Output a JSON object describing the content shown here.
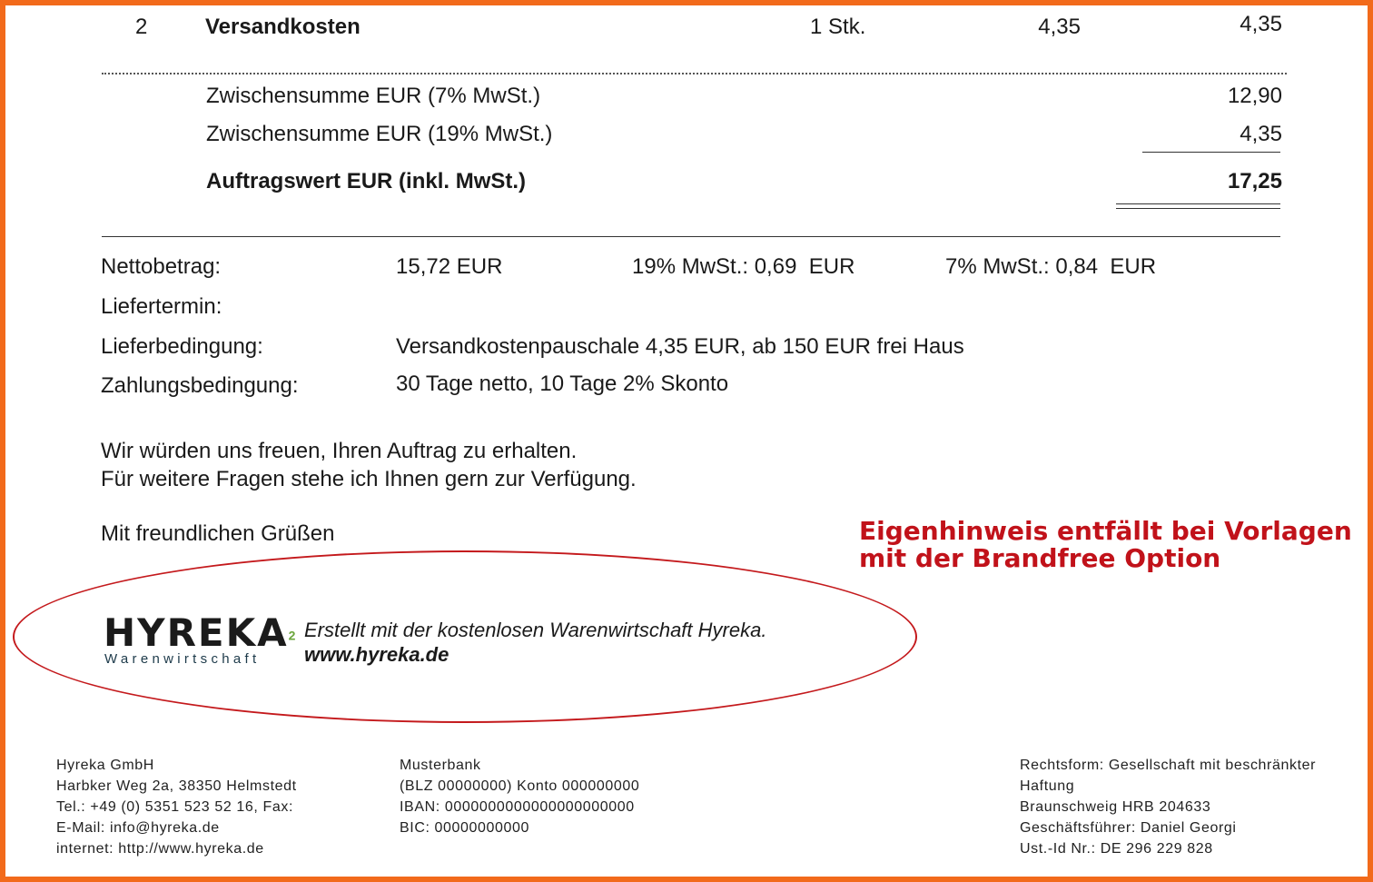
{
  "item_row": {
    "pos": "2",
    "name": "Versandkosten",
    "qty": "1 Stk.",
    "unit_price": "4,35",
    "total": "4,35"
  },
  "subtotals": [
    {
      "label": "Zwischensumme EUR (7% MwSt.)",
      "value": "12,90"
    },
    {
      "label": "Zwischensumme EUR (19% MwSt.)",
      "value": "4,35"
    }
  ],
  "order_total": {
    "label": "Auftragswert EUR (inkl. MwSt.)",
    "value": "17,25"
  },
  "summary": {
    "net_label": "Nettobetrag:",
    "net_value": "15,72 EUR",
    "vat19": "19% MwSt.: 0,69  EUR",
    "vat7": "7% MwSt.: 0,84  EUR",
    "delivery_date_label": "Liefertermin:",
    "delivery_terms_label": "Lieferbedingung:",
    "delivery_terms_value": "Versandkostenpauschale 4,35 EUR, ab 150 EUR frei Haus",
    "payment_terms_label": "Zahlungsbedingung:",
    "payment_terms_value": "30 Tage netto, 10 Tage 2% Skonto"
  },
  "closing": {
    "line1": "Wir würden uns freuen, Ihren Auftrag zu erhalten.",
    "line2": "Für weitere Fragen stehe ich Ihnen gern zur Verfügung.",
    "greeting": "Mit freundlichen Grüßen"
  },
  "note": {
    "line1": "Eigenhinweis entfällt bei Vorlagen",
    "line2": "mit der Brandfree Option",
    "color": "#c1121a"
  },
  "branding": {
    "logo_text": "HYREKA",
    "logo_superscript": "2",
    "logo_subtitle": "Warenwirtschaft",
    "line1": "Erstellt mit der kostenlosen Warenwirtschaft Hyreka.",
    "line2": "www.hyreka.de"
  },
  "footer": {
    "company": [
      "Hyreka GmbH",
      "Harbker Weg 2a, 38350 Helmstedt",
      "Tel.: +49 (0) 5351 523 52 16, Fax:",
      "E-Mail: info@hyreka.de",
      "internet: http://www.hyreka.de"
    ],
    "bank": [
      "Musterbank",
      "(BLZ 00000000) Konto 000000000",
      "IBAN: 0000000000000000000000",
      "BIC: 00000000000"
    ],
    "legal": [
      "Rechtsform: Gesellschaft mit beschränkter",
      "Haftung",
      "Braunschweig HRB 204633",
      "Geschäftsführer: Daniel Georgi",
      "Ust.-Id Nr.: DE 296 229 828"
    ]
  },
  "colors": {
    "frame": "#f26a1b",
    "oval": "#c4191c"
  }
}
